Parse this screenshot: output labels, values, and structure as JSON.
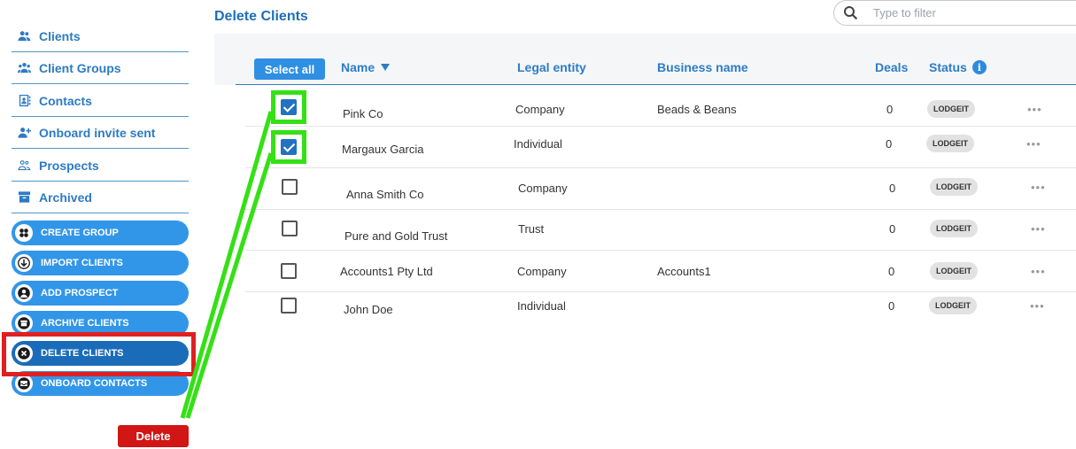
{
  "sidebar": {
    "nav": [
      {
        "label": "Clients",
        "icon": "users-icon"
      },
      {
        "label": "Client Groups",
        "icon": "group-icon"
      },
      {
        "label": "Contacts",
        "icon": "contact-card-icon"
      },
      {
        "label": "Onboard invite sent",
        "icon": "user-plus-icon"
      },
      {
        "label": "Prospects",
        "icon": "prospects-icon"
      },
      {
        "label": "Archived",
        "icon": "archive-icon"
      }
    ],
    "actions": [
      {
        "label": "CREATE GROUP",
        "icon": "group-circle-icon"
      },
      {
        "label": "IMPORT CLIENTS",
        "icon": "download-icon"
      },
      {
        "label": "ADD PROSPECT",
        "icon": "person-icon"
      },
      {
        "label": "ARCHIVE CLIENTS",
        "icon": "archive-box-icon"
      },
      {
        "label": "DELETE CLIENTS",
        "icon": "close-icon",
        "active": true
      },
      {
        "label": "ONBOARD CONTACTS",
        "icon": "inbox-icon"
      }
    ],
    "delete_label": "Delete"
  },
  "main": {
    "title": "Delete Clients",
    "search_placeholder": "Type to filter",
    "select_all_label": "Select all",
    "columns": {
      "name": "Name",
      "legal": "Legal entity",
      "business": "Business name",
      "deals": "Deals",
      "status": "Status"
    },
    "info_glyph": "i",
    "rows": [
      {
        "name": "Pink Co",
        "legal": "Company",
        "business": "Beads & Beans",
        "deals": "0",
        "status": "LODGEIT",
        "checked": true
      },
      {
        "name": "Margaux Garcia",
        "legal": "Individual",
        "business": "",
        "deals": "0",
        "status": "LODGEIT",
        "checked": true
      },
      {
        "name": "Anna Smith Co",
        "legal": "Company",
        "business": "",
        "deals": "0",
        "status": "LODGEIT",
        "checked": false
      },
      {
        "name": "Pure and Gold Trust",
        "legal": "Trust",
        "business": "",
        "deals": "0",
        "status": "LODGEIT",
        "checked": false
      },
      {
        "name": "Accounts1 Pty Ltd",
        "legal": "Company",
        "business": "Accounts1",
        "deals": "0",
        "status": "LODGEIT",
        "checked": false
      },
      {
        "name": "John Doe",
        "legal": "Individual",
        "business": "",
        "deals": "0",
        "status": "LODGEIT",
        "checked": false
      }
    ],
    "more_glyph": "•••"
  },
  "colors": {
    "accent": "#2d7bc4",
    "action_button": "#3296e8",
    "delete_button": "#d21515",
    "highlight_green": "#35e016",
    "highlight_red": "#e02020"
  }
}
